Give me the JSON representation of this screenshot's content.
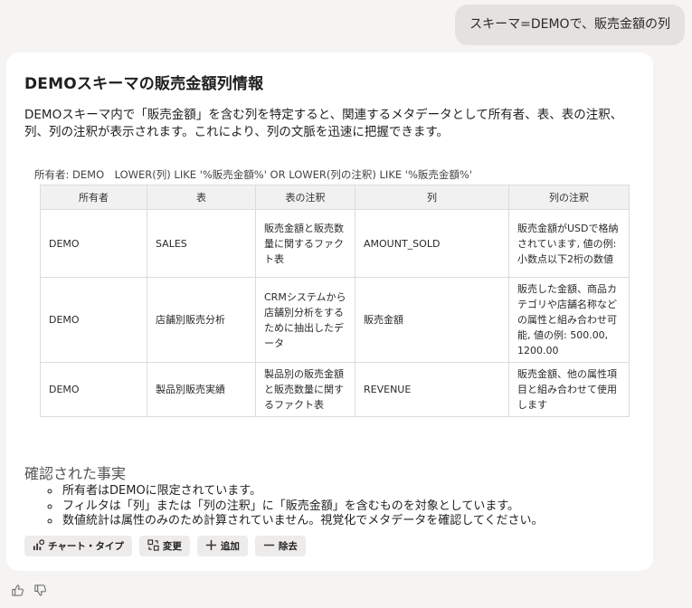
{
  "user_message": "スキーマ=DEMOで、販売金額の列",
  "response": {
    "title": "DEMOスキーマの販売金額列情報",
    "description": "DEMOスキーマ内で「販売金額」を含む列を特定すると、関連するメタデータとして所有者、表、表の注釈、列、列の注釈が表示されます。これにより、列の文脈を迅速に把握できます。",
    "filter_text": "所有者: DEMO　LOWER(列) LIKE '%販売金額%' OR LOWER(列の注釈) LIKE '%販売金額%'",
    "table": {
      "headers": [
        "所有者",
        "表",
        "表の注釈",
        "列",
        "列の注釈"
      ],
      "rows": [
        [
          "DEMO",
          "SALES",
          "販売金額と販売数量に関するファクト表",
          "AMOUNT_SOLD",
          "販売金額がUSDで格納されています, 値の例: 小数点以下2桁の数値"
        ],
        [
          "DEMO",
          "店舗別販売分析",
          "CRMシステムから店舗別分析をするために抽出したデータ",
          "販売金額",
          "販売した金額、商品カテゴリや店舗名称などの属性と組み合わせ可能, 値の例: 500.00, 1200.00"
        ],
        [
          "DEMO",
          "製品別販売実績",
          "製品別の販売金額と販売数量に関するファクト表",
          "REVENUE",
          "販売金額、他の属性項目と組み合わせて使用します"
        ]
      ]
    },
    "facts_title": "確認された事実",
    "facts": [
      "所有者はDEMOに限定されています。",
      "フィルタは「列」または「列の注釈」に「販売金額」を含むものを対象としています。",
      "数値統計は属性のみのため計算されていません。視覚化でメタデータを確認してください。"
    ],
    "actions": {
      "chart_type": "チャート・タイプ",
      "change": "変更",
      "add": "追加",
      "remove": "除去"
    }
  }
}
